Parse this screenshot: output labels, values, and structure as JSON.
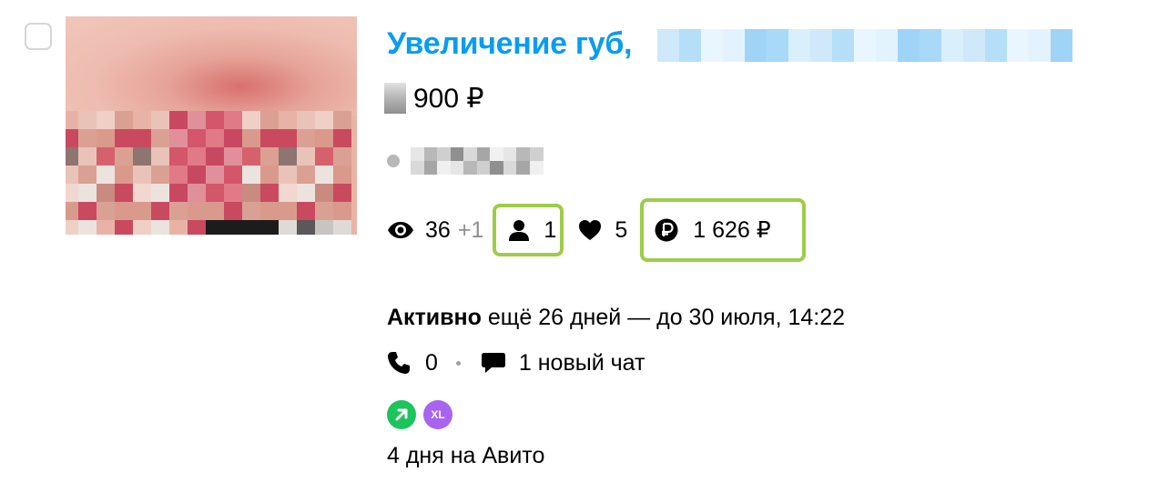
{
  "listing": {
    "title": "Увеличение губ,",
    "price": "900 ₽",
    "stats": {
      "views": "36",
      "views_delta": "+1",
      "contacts": "1",
      "favorites": "5",
      "spent": "1 626 ₽"
    },
    "status_label": "Активно",
    "status_text": "ещё 26 дней — до 30 июля, 14:22",
    "calls": "0",
    "chats": "1 новый чат",
    "badges": {
      "promo_icon": "arrow-up-right-icon",
      "promo_color": "#1dc45c",
      "xl_label": "XL",
      "xl_color": "#a864f0"
    },
    "age": "4 дня на Авито"
  },
  "colors": {
    "title": "#0a9cf1",
    "highlight_border": "#9dcc4a"
  }
}
